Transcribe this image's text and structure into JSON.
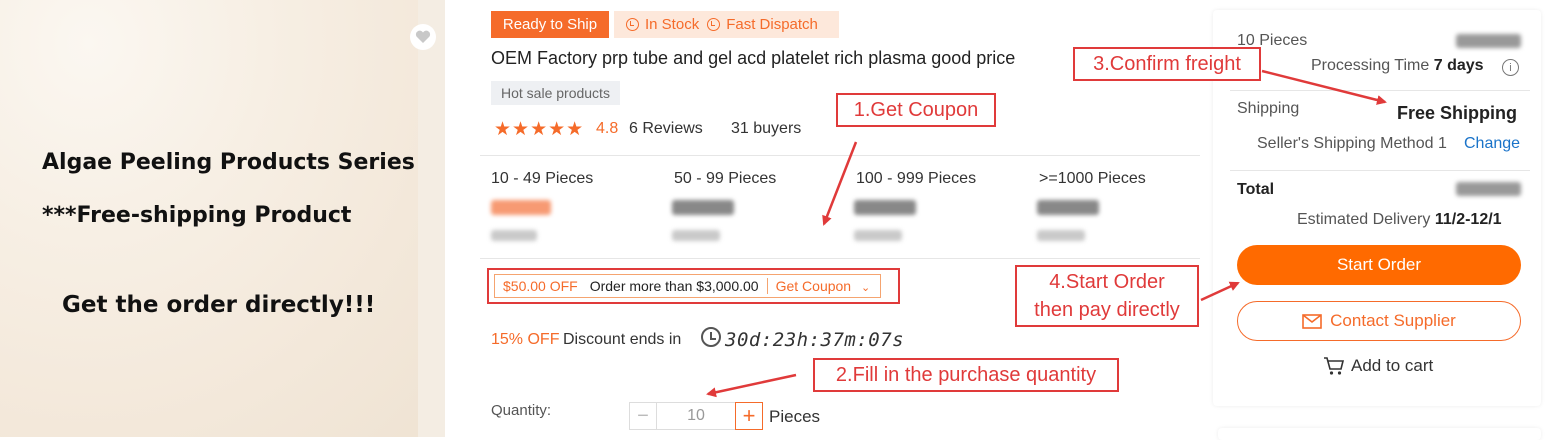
{
  "promo": {
    "line1": "Algae Peeling Products Series",
    "line2": "***Free-shipping Product",
    "line3": "Get the order directly!!!"
  },
  "badges": {
    "ready": "Ready to Ship",
    "in_stock": "In Stock",
    "fast_dispatch": "Fast Dispatch"
  },
  "product": {
    "title": "OEM Factory prp tube and gel acd platelet rich plasma good price",
    "tag": "Hot sale products",
    "stars": "★★★★★",
    "rating": "4.8",
    "reviews": "6 Reviews",
    "buyers": "31 buyers"
  },
  "tiers": [
    {
      "label": "10 - 49 Pieces"
    },
    {
      "label": "50 - 99 Pieces"
    },
    {
      "label": "100 - 999 Pieces"
    },
    {
      "label": ">=1000 Pieces"
    }
  ],
  "coupon": {
    "off": "$50.00 OFF",
    "condition": "Order more than $3,000.00",
    "get": "Get Coupon",
    "chevron": "⌄"
  },
  "discount": {
    "off": "15% OFF",
    "ends": "Discount ends in",
    "timer": "30d:23h:37m:07s"
  },
  "quantity": {
    "label": "Quantity:",
    "minus": "−",
    "value": "10",
    "plus": "+",
    "unit": "Pieces"
  },
  "order": {
    "pieces": "10 Pieces",
    "processing_label": "Processing Time",
    "processing_value": "7 days",
    "info_icon": "i",
    "shipping_label": "Shipping",
    "shipping_value": "Free Shipping",
    "method": "Seller's Shipping Method 1",
    "change": "Change",
    "total_label": "Total",
    "delivery_label": "Estimated Delivery",
    "delivery_value": "11/2-12/1",
    "start_order": "Start Order",
    "contact": "Contact Supplier",
    "add_cart": "Add to cart"
  },
  "callouts": {
    "c1": "1.Get Coupon",
    "c2": "2.Fill in the purchase quantity",
    "c3": "3.Confirm freight",
    "c4_line1": "4.Start Order",
    "c4_line2": "then pay directly"
  },
  "colors": {
    "accent": "#f56b2a",
    "button": "#ff6a00",
    "annotation": "#e03a3a",
    "link": "#1a73c9"
  },
  "icons": [
    "heart-icon",
    "clock-icon",
    "star-icon",
    "timer-icon",
    "info-icon",
    "mail-icon",
    "cart-icon",
    "chevron-down-icon"
  ]
}
